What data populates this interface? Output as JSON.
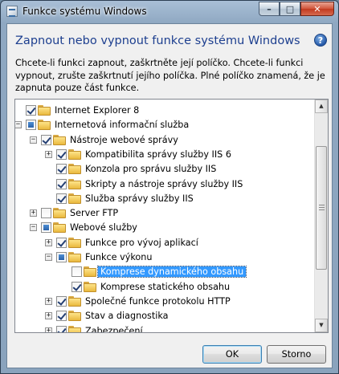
{
  "window": {
    "title": "Funkce systému Windows",
    "minimize_glyph": "–",
    "maximize_glyph": "□",
    "close_glyph": "✕"
  },
  "header": {
    "heading": "Zapnout nebo vypnout funkce systému Windows",
    "help_glyph": "?",
    "description": "Chcete-li funkci zapnout, zaškrtněte její políčko. Chcete-li funkci vypnout, zrušte zaškrtnutí jejího políčka. Plné políčko znamená, že je zapnuta pouze část funkce."
  },
  "tree": {
    "items": [
      {
        "label": "Internet Explorer 8",
        "level": 0,
        "expander": "",
        "state": "checked",
        "selected": false
      },
      {
        "label": "Internetová informační služba",
        "level": 0,
        "expander": "−",
        "state": "partial",
        "selected": false
      },
      {
        "label": "Nástroje webové správy",
        "level": 1,
        "expander": "−",
        "state": "checked",
        "selected": false
      },
      {
        "label": "Kompatibilita správy služby IIS 6",
        "level": 2,
        "expander": "+",
        "state": "checked",
        "selected": false
      },
      {
        "label": "Konzola pro správu služby IIS",
        "level": 2,
        "expander": "",
        "state": "checked",
        "selected": false
      },
      {
        "label": "Skripty a nástroje správy služby IIS",
        "level": 2,
        "expander": "",
        "state": "checked",
        "selected": false
      },
      {
        "label": "Služba správy služby IIS",
        "level": 2,
        "expander": "",
        "state": "checked",
        "selected": false
      },
      {
        "label": "Server FTP",
        "level": 1,
        "expander": "+",
        "state": "unchecked",
        "selected": false
      },
      {
        "label": "Webové služby",
        "level": 1,
        "expander": "−",
        "state": "partial",
        "selected": false
      },
      {
        "label": "Funkce pro vývoj aplikací",
        "level": 2,
        "expander": "+",
        "state": "checked",
        "selected": false
      },
      {
        "label": "Funkce výkonu",
        "level": 2,
        "expander": "−",
        "state": "partial",
        "selected": false
      },
      {
        "label": "Komprese dynamického obsahu",
        "level": 3,
        "expander": "",
        "state": "unchecked",
        "selected": true
      },
      {
        "label": "Komprese statického obsahu",
        "level": 3,
        "expander": "",
        "state": "checked",
        "selected": false
      },
      {
        "label": "Společné funkce protokolu HTTP",
        "level": 2,
        "expander": "+",
        "state": "checked",
        "selected": false
      },
      {
        "label": "Stav a diagnostika",
        "level": 2,
        "expander": "+",
        "state": "checked",
        "selected": false
      },
      {
        "label": "Zabezpečení",
        "level": 2,
        "expander": "+",
        "state": "checked",
        "selected": false
      }
    ],
    "scroll_up_glyph": "▲",
    "scroll_down_glyph": "▼"
  },
  "buttons": {
    "ok": "OK",
    "cancel": "Storno"
  },
  "colors": {
    "heading": "#1d3f8f",
    "selection": "#3399ff",
    "folder": "#eab93e"
  }
}
